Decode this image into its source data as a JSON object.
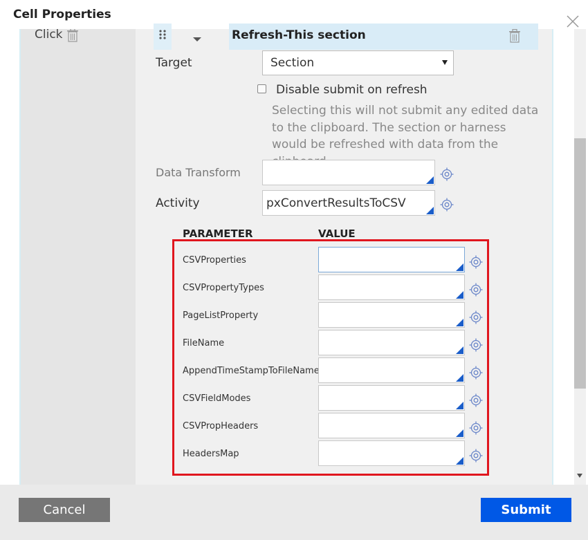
{
  "dialog": {
    "title": "Cell Properties"
  },
  "event": {
    "label": "Click"
  },
  "action": {
    "title": "Refresh-This section"
  },
  "target": {
    "label": "Target",
    "value": "Section"
  },
  "disable_submit": {
    "label": "Disable submit on refresh",
    "checked": false,
    "help": "Selecting this will not submit any edited data to the clipboard. The section or harness would be refreshed with data from the clipboard."
  },
  "data_transform": {
    "label": "Data Transform",
    "value": ""
  },
  "activity": {
    "label": "Activity",
    "value": "pxConvertResultsToCSV"
  },
  "params": {
    "header_parameter": "PARAMETER",
    "header_value": "VALUE",
    "rows": [
      {
        "name": "CSVProperties",
        "value": ""
      },
      {
        "name": "CSVPropertyTypes",
        "value": ""
      },
      {
        "name": "PageListProperty",
        "value": ""
      },
      {
        "name": "FileName",
        "value": ""
      },
      {
        "name": "AppendTimeStampToFileName",
        "value": ""
      },
      {
        "name": "CSVFieldModes",
        "value": ""
      },
      {
        "name": "CSVPropHeaders",
        "value": ""
      },
      {
        "name": "HeadersMap",
        "value": ""
      }
    ]
  },
  "footer": {
    "cancel_label": "Cancel",
    "submit_label": "Submit"
  },
  "colors": {
    "submit": "#0058e6",
    "cancel": "#767676",
    "highlight_box": "#e0161e",
    "action_header": "#d9ecf7",
    "input_corner": "#1a5dc9"
  },
  "icons": {
    "close": "close-icon",
    "trash": "trash-icon",
    "drag": "drag-handle-icon",
    "caret": "caret-down-icon",
    "gear": "target-gear-icon"
  }
}
